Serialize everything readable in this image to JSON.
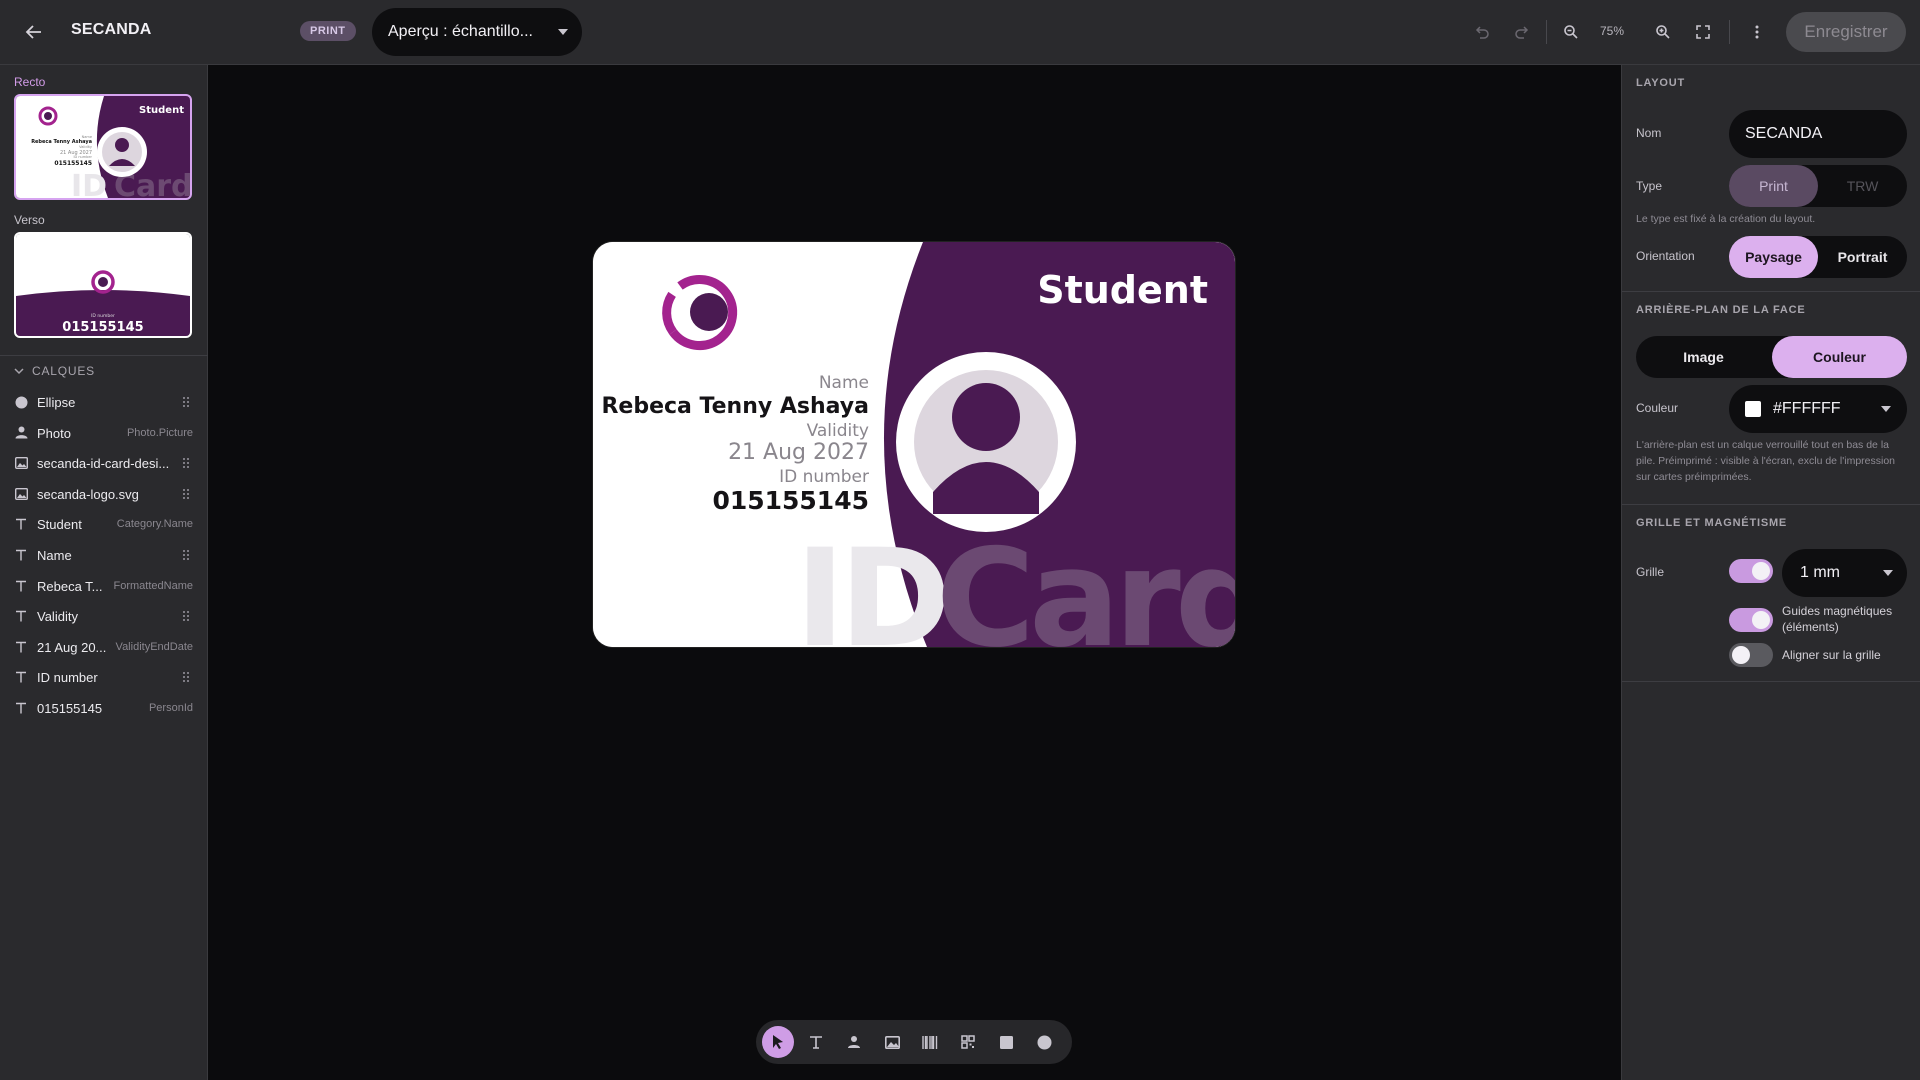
{
  "header": {
    "title": "SECANDA",
    "type_badge": "PRINT",
    "preview_select": "Aperçu : échantillo...",
    "zoom_level": "75%",
    "save_label": "Enregistrer"
  },
  "faces": {
    "front_label": "Recto",
    "back_label": "Verso",
    "back_thumb_small_label": "ID number",
    "back_thumb_number": "015155145"
  },
  "layers": {
    "header": "CALQUES",
    "items": [
      {
        "icon": "ellipse-icon",
        "name": "Ellipse",
        "binding": ""
      },
      {
        "icon": "person-icon",
        "name": "Photo",
        "binding": "Photo.Picture"
      },
      {
        "icon": "image-icon",
        "name": "secanda-id-card-desi...",
        "binding": ""
      },
      {
        "icon": "image-icon",
        "name": "secanda-logo.svg",
        "binding": ""
      },
      {
        "icon": "text-icon",
        "name": "Student",
        "binding": "Category.Name"
      },
      {
        "icon": "text-icon",
        "name": "Name",
        "binding": ""
      },
      {
        "icon": "text-icon",
        "name": "Rebeca T...",
        "binding": "FormattedName"
      },
      {
        "icon": "text-icon",
        "name": "Validity",
        "binding": ""
      },
      {
        "icon": "text-icon",
        "name": "21 Aug 20...",
        "binding": "ValidityEndDate"
      },
      {
        "icon": "text-icon",
        "name": "ID number",
        "binding": ""
      },
      {
        "icon": "text-icon",
        "name": "015155145",
        "binding": "PersonId"
      }
    ]
  },
  "card": {
    "category": "Student",
    "name_label": "Name",
    "name_value": "Rebeca Tenny Ashaya",
    "validity_label": "Validity",
    "validity_value": "21 Aug 2027",
    "id_label": "ID number",
    "id_value": "015155145",
    "watermark_left": "ID",
    "watermark_right": "Card",
    "accent_color": "#4a1a52",
    "logo_color": "#a3238e"
  },
  "tools": [
    "pointer-icon",
    "text-icon",
    "person-icon",
    "image-icon",
    "barcode-icon",
    "qrcode-icon",
    "rectangle-icon",
    "circle-icon"
  ],
  "properties": {
    "layout_title": "LAYOUT",
    "name_label": "Nom",
    "name_value": "SECANDA",
    "type_label": "Type",
    "type_options": [
      "Print",
      "TRW"
    ],
    "type_hint": "Le type est fixé à la création du layout.",
    "orientation_label": "Orientation",
    "orientation_options": [
      "Paysage",
      "Portrait"
    ],
    "background_title": "ARRIÈRE-PLAN DE LA FACE",
    "background_options": [
      "Image",
      "Couleur"
    ],
    "color_label": "Couleur",
    "color_value": "#FFFFFF",
    "background_hint": "L'arrière-plan est un calque verrouillé tout en bas de la pile. Préimprimé : visible à l'écran, exclu de l'impression sur cartes préimprimées.",
    "grid_title": "GRILLE ET MAGNÉTISME",
    "grid_label": "Grille",
    "grid_size": "1 mm",
    "snap_guides_label": "Guides magnétiques (éléments)",
    "snap_grid_label": "Aligner sur la grille",
    "grid_enabled": true,
    "snap_guides_enabled": true,
    "snap_grid_enabled": false
  }
}
